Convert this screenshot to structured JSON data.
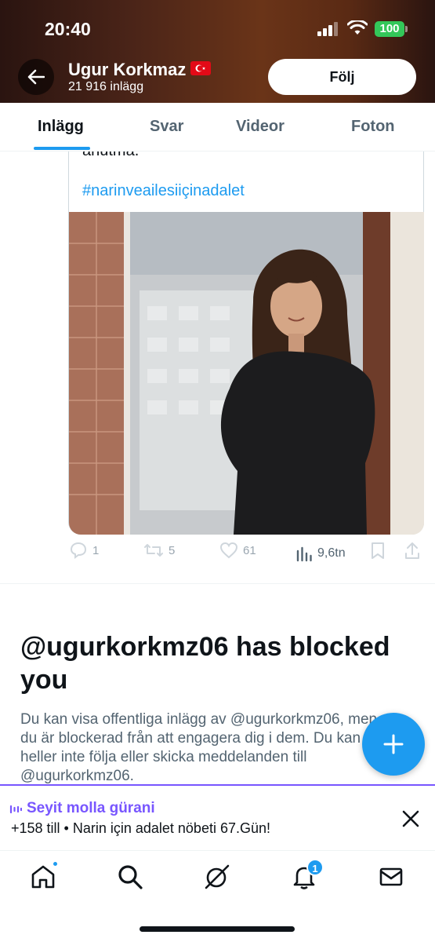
{
  "status_bar": {
    "time": "20:40",
    "battery": "100"
  },
  "header": {
    "name": "Ugur Korkmaz",
    "post_count": "21 916 inlägg",
    "follow_label": "Följ"
  },
  "tabs": [
    {
      "label": "Inlägg",
      "active": true
    },
    {
      "label": "Svar",
      "active": false
    },
    {
      "label": "Videor",
      "active": false
    },
    {
      "label": "Foton",
      "active": false
    }
  ],
  "tweet": {
    "partial_text": "anutma.",
    "hashtag": "#narinveailesiiçinadalet",
    "actions": {
      "replies": "1",
      "retweets": "5",
      "likes": "61",
      "views": "9,6tn"
    }
  },
  "blocked": {
    "title": "@ugurkorkmz06 has blocked you",
    "body": "Du kan visa offentliga inlägg av @ugurkorkmz06, men du är blockerad från att engagera dig i dem. Du kan heller inte följa eller skicka meddelanden till @ugurkorkmz06."
  },
  "spaces": {
    "title": "Seyit molla gürani",
    "subtitle": "+158 till • Narin için adalet nöbeti 67.Gün!"
  },
  "nav": {
    "notifications_badge": "1"
  },
  "colors": {
    "accent": "#1d9bf0",
    "spaces": "#7856ff",
    "battery": "#33c759"
  }
}
